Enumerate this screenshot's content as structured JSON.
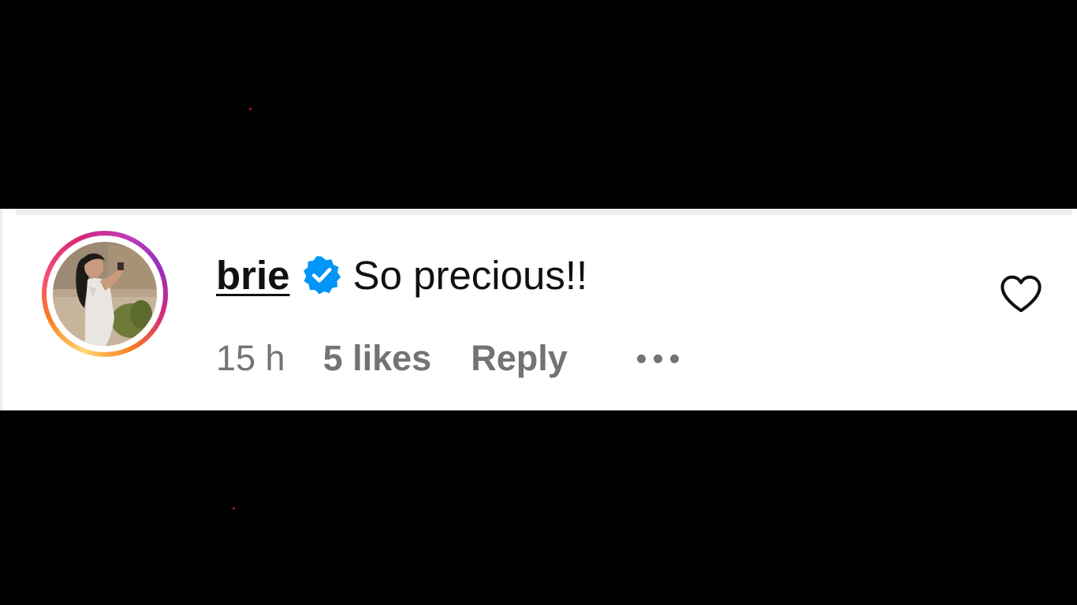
{
  "comment": {
    "username": "brie",
    "verified": true,
    "text": "So precious!!",
    "time_ago": "15 h",
    "likes_label": "5 likes",
    "reply_label": "Reply"
  },
  "icons": {
    "verified": "verified-badge-icon",
    "more": "more-options-icon",
    "like": "heart-outline-icon"
  },
  "colors": {
    "background": "#000000",
    "card": "#ffffff",
    "text": "#111111",
    "muted": "#737373",
    "verified": "#0095f6",
    "ring_start": "#feda75",
    "ring_end": "#962fbf"
  }
}
